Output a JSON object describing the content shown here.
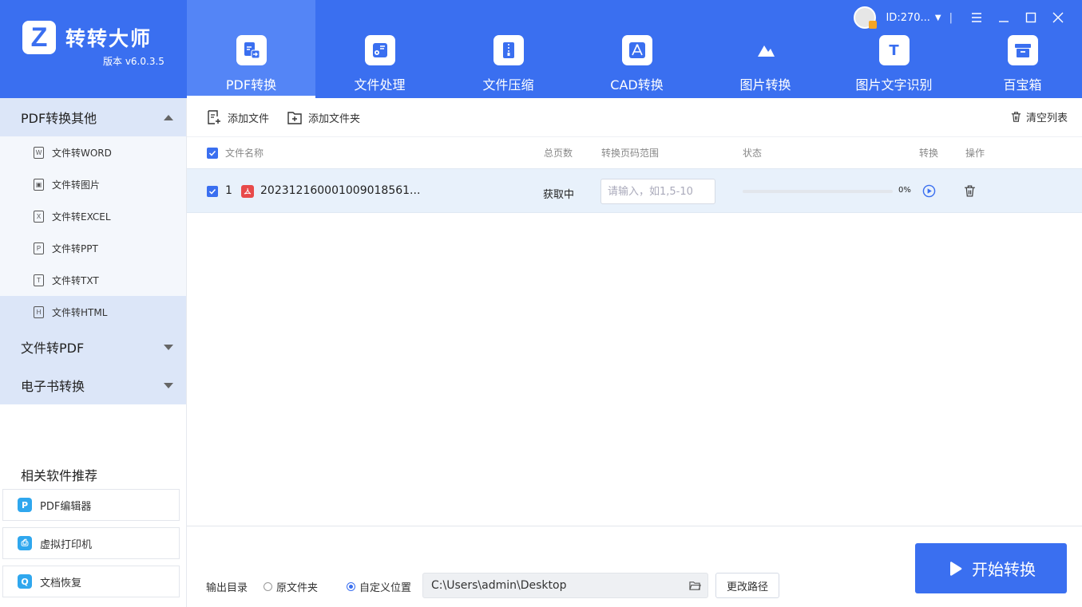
{
  "app": {
    "name": "转转大师",
    "version": "版本 v6.0.3.5",
    "logo_letter": "Z"
  },
  "user": {
    "id": "ID:270..."
  },
  "nav": [
    {
      "label": "PDF转换",
      "icon": "pdf-convert-icon",
      "active": true
    },
    {
      "label": "文件处理",
      "icon": "file-process-icon"
    },
    {
      "label": "文件压缩",
      "icon": "zip-icon"
    },
    {
      "label": "CAD转换",
      "icon": "cad-icon"
    },
    {
      "label": "图片转换",
      "icon": "image-icon"
    },
    {
      "label": "图片文字识别",
      "icon": "ocr-icon",
      "glyph": "T"
    },
    {
      "label": "百宝箱",
      "icon": "toolbox-icon"
    }
  ],
  "sidebar": {
    "cat1": "PDF转换其他",
    "subs": [
      {
        "label": "文件转WORD",
        "glyph": "W"
      },
      {
        "label": "文件转图片",
        "glyph": "▣"
      },
      {
        "label": "文件转EXCEL",
        "glyph": "X"
      },
      {
        "label": "文件转PPT",
        "glyph": "P"
      },
      {
        "label": "文件转TXT",
        "glyph": "T"
      },
      {
        "label": "文件转HTML",
        "glyph": "H"
      }
    ],
    "cat2": "文件转PDF",
    "cat3": "电子书转换",
    "rec_title": "相关软件推荐",
    "recs": [
      {
        "label": "PDF编辑器",
        "glyph": "P"
      },
      {
        "label": "虚拟打印机",
        "glyph": "⎙"
      },
      {
        "label": "文档恢复",
        "glyph": "Q"
      }
    ]
  },
  "toolbar": {
    "add_file": "添加文件",
    "add_folder": "添加文件夹",
    "clear_list": "清空列表"
  },
  "table": {
    "headers": {
      "name": "文件名称",
      "pages": "总页数",
      "range": "转换页码范围",
      "status": "状态",
      "convert": "转换",
      "action": "操作"
    },
    "rows": [
      {
        "index": "1",
        "filename": "20231216000100901856​1...",
        "pages": "获取中",
        "range_placeholder": "请输入，如1,5-10",
        "progress_text": "0%",
        "progress": 0
      }
    ]
  },
  "footer": {
    "output_label": "输出目录",
    "option_original": "原文件夹",
    "option_custom": "自定义位置",
    "path": "C:\\Users\\admin\\Desktop",
    "change_path": "更改路径",
    "start": "开始转换"
  },
  "colors": {
    "brand": "#3a6ff0",
    "sidebar_active": "#dce6f8",
    "row_selected": "#e8f1fb"
  }
}
